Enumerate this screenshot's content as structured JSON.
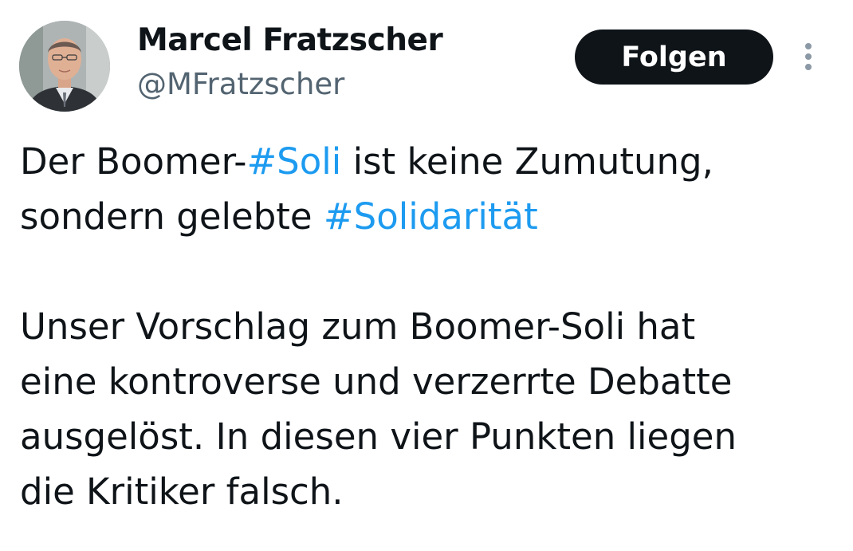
{
  "author": {
    "name": "Marcel Fratzscher",
    "handle": "@MFratzscher"
  },
  "header": {
    "follow_label": "Folgen"
  },
  "icons": {
    "more": "more-vertical-icon"
  },
  "colors": {
    "text": "#0f1419",
    "secondary_text": "#536471",
    "hashtag": "#1d9bf0",
    "follow_button_bg": "#0f1419",
    "follow_button_text": "#ffffff"
  },
  "tweet": {
    "p1": {
      "l1_a": "Der Boomer-",
      "l1_tag": "#Soli",
      "l1_b": " ist keine Zumutung,",
      "l2_a": "sondern gelebte ",
      "l2_tag": "#Solidarität"
    },
    "p2": {
      "l1": "Unser Vorschlag zum Boomer-Soli hat",
      "l2": "eine kontroverse und verzerrte Debatte",
      "l3": "ausgelöst. In diesen vier Punkten liegen",
      "l4": "die Kritiker falsch."
    }
  }
}
